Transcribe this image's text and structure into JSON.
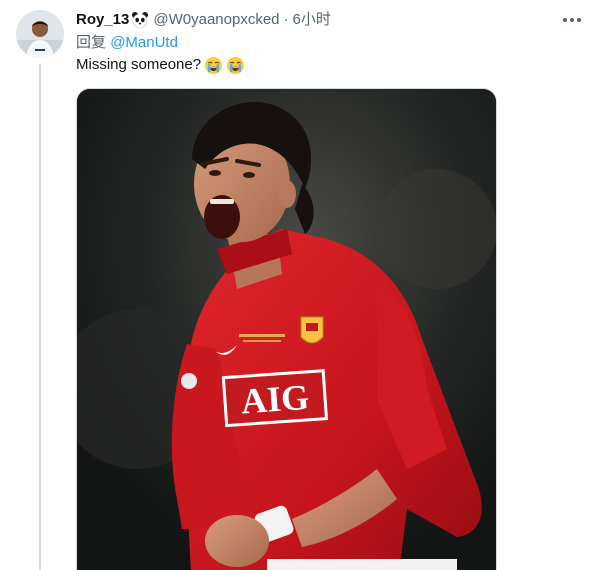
{
  "tweet": {
    "display_name": "Roy_13",
    "handle": "@W0yaanopxcked",
    "separator": "·",
    "time": "6小时",
    "reply_prefix": "回复",
    "reply_to": "@ManUtd",
    "text": "Missing someone?",
    "emojis": [
      "loudly-crying-face",
      "loudly-crying-face"
    ],
    "name_badge_icon": "panda-icon",
    "more_icon": "more-horizontal-icon"
  },
  "media": {
    "shirt_sponsor": "AIG"
  },
  "colors": {
    "link": "#1d9bf0",
    "secondary_text": "#536471",
    "primary_text": "#0f1419",
    "thread_line": "#cfd9de",
    "jersey_red": "#d3181f"
  }
}
